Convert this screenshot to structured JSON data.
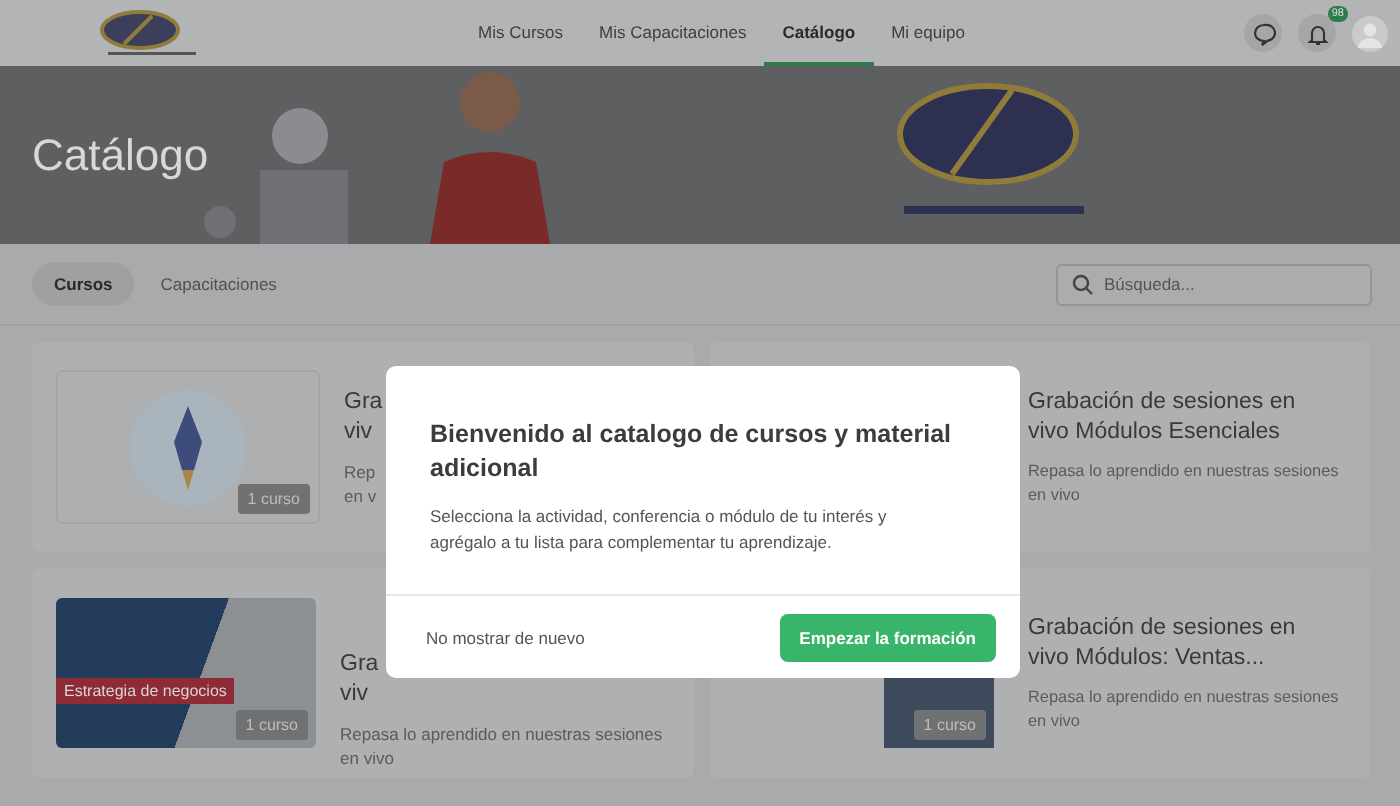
{
  "nav": {
    "items": [
      {
        "label": "Mis Cursos",
        "selected": false
      },
      {
        "label": "Mis Capacitaciones",
        "selected": false
      },
      {
        "label": "Catálogo",
        "selected": true
      },
      {
        "label": "Mi equipo",
        "selected": false
      }
    ],
    "notification_count": "98"
  },
  "banner": {
    "title": "Catálogo"
  },
  "tabs": [
    {
      "label": "Cursos",
      "selected": true
    },
    {
      "label": "Capacitaciones",
      "selected": false
    }
  ],
  "search": {
    "placeholder": "Búsqueda..."
  },
  "cards": [
    {
      "kind": "rocket",
      "badge": "1 curso",
      "title_lines": [
        "Gra",
        "viv"
      ],
      "description_lines": [
        "Rep",
        "en v"
      ]
    },
    {
      "kind": "covered",
      "title_lines": [
        "Grabación de sesiones en",
        "vivo Módulos Esenciales"
      ],
      "description_lines": [
        "Repasa lo aprendido en nuestras sesiones",
        "en vivo"
      ]
    },
    {
      "kind": "business",
      "badge": "1 curso",
      "image_caption": "Estrategia de negocios",
      "title_lines": [
        "Gra",
        "viv"
      ],
      "description_lines": [
        "Repasa lo aprendido en nuestras sesiones",
        "en vivo"
      ]
    },
    {
      "kind": "partial",
      "badge": "1 curso",
      "title_lines": [
        "Grabación de sesiones en",
        "vivo Módulos: Ventas..."
      ],
      "description_lines": [
        "Repasa lo aprendido en nuestras sesiones",
        "en vivo"
      ]
    }
  ],
  "modal": {
    "title": "Bienvenido al catalogo de cursos y material adicional",
    "body": "Selecciona la actividad, conferencia o módulo de tu interés y agrégalo a tu lista para complementar tu aprendizaje.",
    "dismiss": "No mostrar de nuevo",
    "confirm": "Empezar la formación"
  }
}
